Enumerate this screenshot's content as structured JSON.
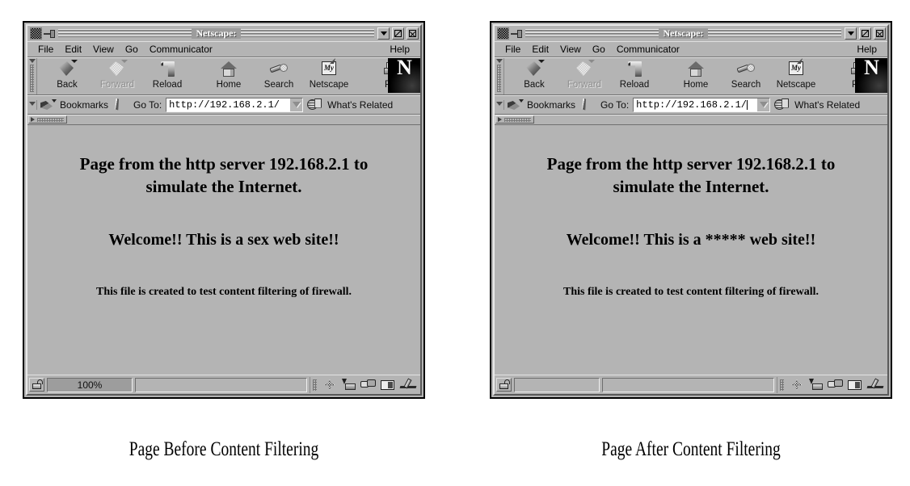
{
  "figure": {
    "caption_left": "Page Before Content Filtering",
    "caption_right": "Page After Content Filtering"
  },
  "browser": {
    "title": "Netscape:",
    "menu": [
      "File",
      "Edit",
      "View",
      "Go",
      "Communicator"
    ],
    "help_label": "Help",
    "window_buttons": {
      "minimize": "minimize-icon",
      "maximize": "maximize-icon",
      "close": "close-icon"
    },
    "toolbar": [
      {
        "label": "Back",
        "icon": "back-arrow-icon",
        "disabled": false
      },
      {
        "label": "Forward",
        "icon": "forward-arrow-icon",
        "disabled": true
      },
      {
        "label": "Reload",
        "icon": "reload-icon",
        "disabled": false
      },
      {
        "label": "Home",
        "icon": "home-icon",
        "disabled": false
      },
      {
        "label": "Search",
        "icon": "search-flashlight-icon",
        "disabled": false
      },
      {
        "label": "Netscape",
        "icon": "my-netscape-icon",
        "disabled": false
      },
      {
        "label": "Pri",
        "icon": "print-icon",
        "disabled": false
      }
    ],
    "logo_letter": "N",
    "mynetscape_glyph": "My",
    "location": {
      "bookmarks_label": "Bookmarks",
      "goto_label": "Go To:",
      "whats_related_label": "What's Related",
      "url": "http://192.168.2.1/"
    },
    "statusbar": {
      "progress_left": "100%",
      "progress_right": "",
      "message": "",
      "component_icons": [
        "navigator-icon",
        "mailbox-icon",
        "discussions-icon",
        "address-book-icon",
        "composer-icon"
      ]
    }
  },
  "page_before": {
    "heading": "Page from the http server 192.168.2.1 to simulate the Internet.",
    "welcome": "Welcome!! This is a sex web site!!",
    "note": "This file is created to test content filtering of firewall."
  },
  "page_after": {
    "heading": "Page from the http server 192.168.2.1 to simulate the Internet.",
    "welcome": "Welcome!! This is a  ***** web site!!",
    "note": "This file is created to test content filtering of firewall."
  },
  "colors": {
    "window_face": "#b4b4b4",
    "page_background": "#b4b4b4",
    "title_text": "#ffffff",
    "title_plate": "#9c9c9c",
    "logo_background": "#000000"
  }
}
